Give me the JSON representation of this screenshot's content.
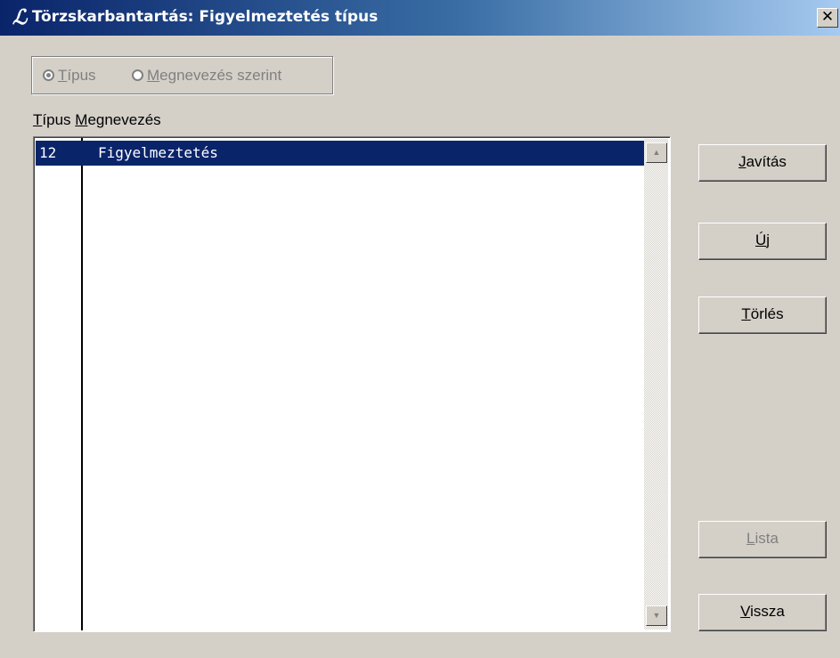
{
  "window": {
    "title": "Törzskarbantartás: Figyelmeztetés típus",
    "app_icon_glyph": "ℒ",
    "close_glyph": "✕"
  },
  "sort_options": [
    {
      "label": "Típus",
      "selected": true
    },
    {
      "label": "Megnevezés szerint",
      "selected": false
    }
  ],
  "columns": {
    "col1": "Típus",
    "col2": "Megnevezés"
  },
  "rows": [
    {
      "type": "12",
      "name": "Figyelmeztetés",
      "selected": true
    }
  ],
  "scrollbar": {
    "up_glyph": "▲",
    "down_glyph": "▼"
  },
  "buttons": {
    "edit": "Javítás",
    "new": "Új",
    "delete": "Törlés",
    "list": "Lista",
    "back": "Vissza"
  },
  "colors": {
    "selection": "#0a246a",
    "face": "#d4d0c8"
  }
}
